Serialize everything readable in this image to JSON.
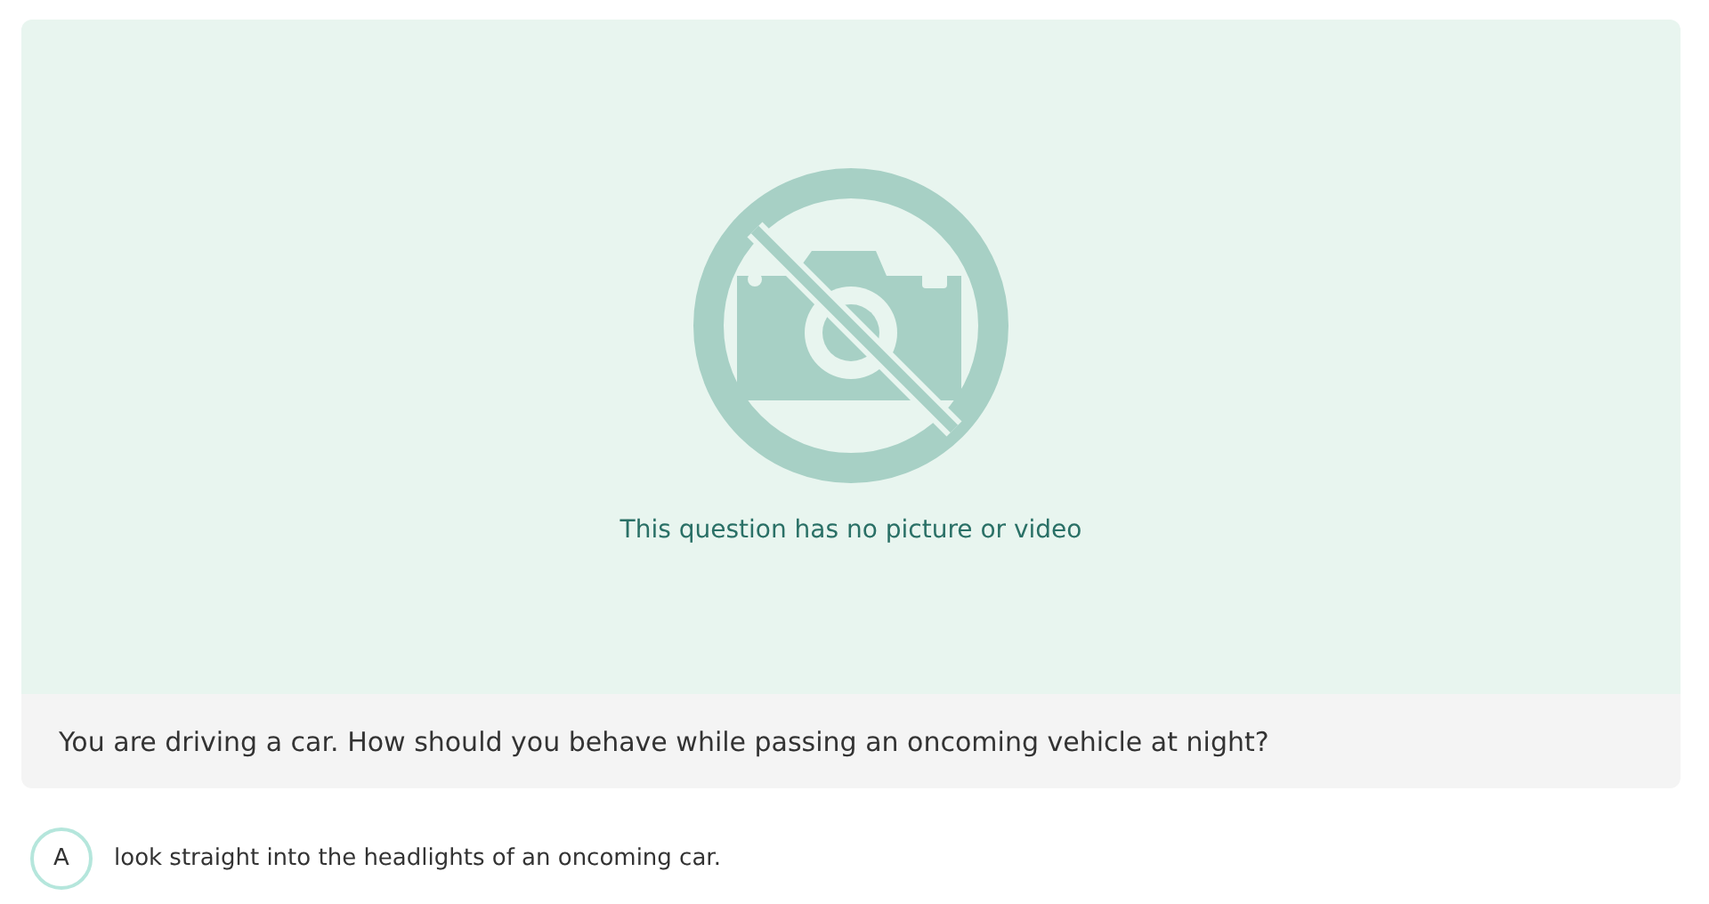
{
  "media": {
    "message": "This question has no picture or video"
  },
  "question": {
    "text": "You are driving a car. How should you behave while passing an oncoming vehicle at night?"
  },
  "answers": [
    {
      "letter": "A",
      "text": "look straight into the headlights of an oncoming car.",
      "selected": false
    }
  ]
}
